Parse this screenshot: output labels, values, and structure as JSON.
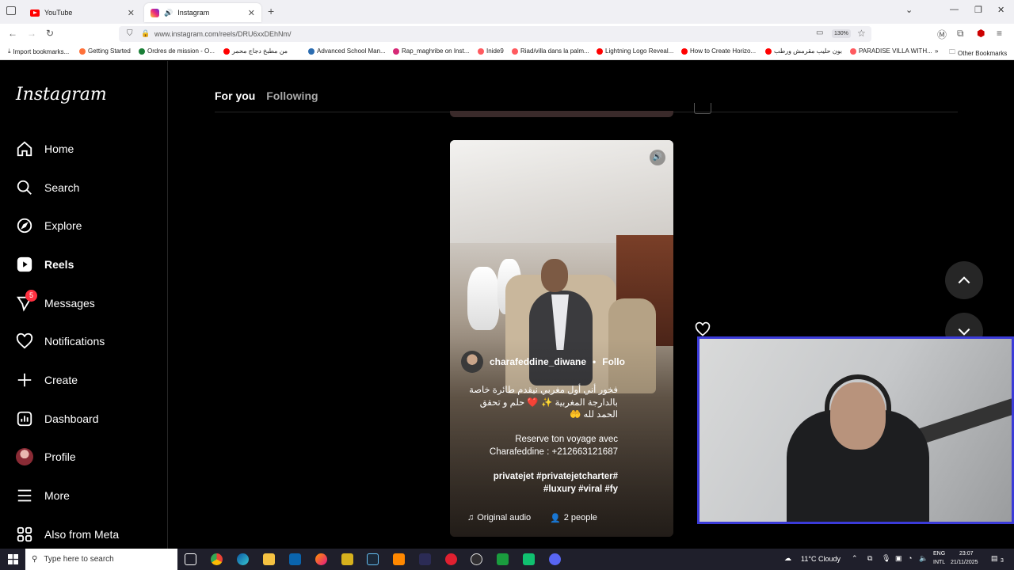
{
  "browser": {
    "tabs": [
      {
        "label": "YouTube"
      },
      {
        "label": "Instagram"
      }
    ],
    "url": "www.instagram.com/reels/DRU6xxDEhNm/",
    "zoom": "130%",
    "bookmarks": [
      "Import bookmarks...",
      "Getting Started",
      "Ordres de mission - O...",
      "من مطبخ دجاج محمر",
      "Advanced School Man...",
      "Rap_maghribe on Inst...",
      "Inide9",
      "Riad/villa dans la palm...",
      "Lightning Logo Reveal...",
      "How to Create Horizo...",
      "بون حليب مقرمش ورطب",
      "PARADISE VILLA WITH...",
      "Other Bookmarks"
    ]
  },
  "sidebar": {
    "logo": "Instagram",
    "items": [
      {
        "label": "Home"
      },
      {
        "label": "Search"
      },
      {
        "label": "Explore"
      },
      {
        "label": "Reels"
      },
      {
        "label": "Messages",
        "badge": "5"
      },
      {
        "label": "Notifications"
      },
      {
        "label": "Create"
      },
      {
        "label": "Dashboard"
      },
      {
        "label": "Profile"
      },
      {
        "label": "More"
      },
      {
        "label": "Also from Meta"
      }
    ]
  },
  "main": {
    "tabs": [
      "For you",
      "Following"
    ],
    "reel": {
      "author": "charafeddine_diwane",
      "separator": "•",
      "follow": "Follo",
      "caption_ar": "فخور أني أول مغربي نيقدم طائرة خاصة\nبالدارجة المغربية ✨ ❤️ حلم و تحقق\nالحمد لله 🤲",
      "caption_fr": "Reserve ton voyage avec\nCharafeddine : +212663121687",
      "hashtags": "privatejet #privatejetcharter#\n#luxury #viral #fy",
      "audio": "Original audio",
      "people": "2 people"
    }
  },
  "taskbar": {
    "search_placeholder": "Type here to search",
    "weather": "11°C  Cloudy",
    "lang_top": "ENG",
    "lang_bottom": "INTL",
    "time": "23:07",
    "date": "21/11/2025",
    "notif_count": "3"
  },
  "colors": {
    "ig_bg": "#000000",
    "badge": "#ff3040",
    "cam_border": "#3b3bd9",
    "taskbar": "#1f1f2b"
  }
}
